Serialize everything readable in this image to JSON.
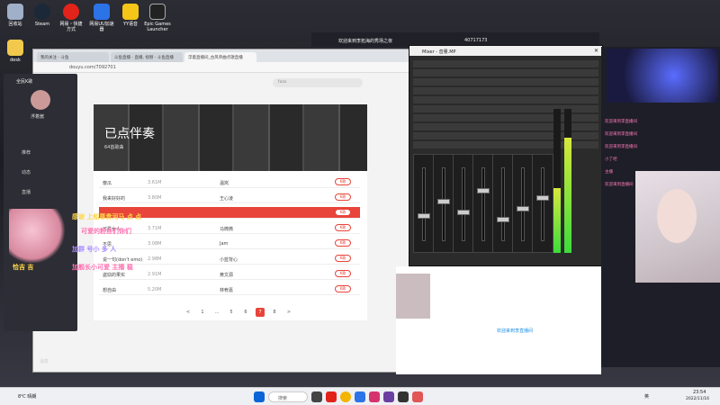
{
  "desktop": {
    "icons": [
      {
        "label": "回收站",
        "color": "#9fb0c8"
      },
      {
        "label": "Steam",
        "color": "#1b2838"
      },
      {
        "label": "网易・快捷\n方式",
        "color": "#e2231a"
      },
      {
        "label": "网易UU加速\n器",
        "color": "#2b73e6"
      },
      {
        "label": "YY语音",
        "color": "#f5c518"
      },
      {
        "label": "Epic Games\nLauncher",
        "color": "#222"
      },
      {
        "label": "desk",
        "color": "#f2c94c"
      }
    ]
  },
  "browser": {
    "tabs": [
      "我的关注 - 斗鱼",
      "斗鱼直播 - 直播, 视频 - 斗鱼直播",
      "浮着直播间_古风单曲点歌直播"
    ],
    "address": "douyu.com/7092701",
    "search_placeholder": "fazo"
  },
  "app_sidebar": {
    "title": "全民K歌",
    "user": "浮着酱",
    "items": [
      "推荐",
      "动态",
      "直播",
      "",
      "消息"
    ]
  },
  "panel": {
    "title": "已点伴奏",
    "subtitle": "64首歌曲",
    "rows": [
      {
        "name": "傻瓜",
        "size": "3.61M",
        "singer": "温岚",
        "btn": "K歌"
      },
      {
        "name": "我来好好的",
        "size": "3.80M",
        "singer": "王心凌",
        "btn": "K歌"
      },
      {
        "name": "",
        "size": "",
        "singer": "",
        "btn": "K歌",
        "highlight": true
      },
      {
        "name": "可爱女人",
        "size": "3.71M",
        "singer": "马微微",
        "btn": "K歌"
      },
      {
        "name": "不思",
        "size": "3.08M",
        "singer": "Jam",
        "btn": "K歌"
      },
      {
        "name": "说一句(don't emo)",
        "size": "2.98M",
        "singer": "小蓝背心",
        "btn": "K歌"
      },
      {
        "name": "盗窃的果实",
        "size": "2.91M",
        "singer": "黄文源",
        "btn": "K歌"
      },
      {
        "name": "想自由",
        "size": "5.20M",
        "singer": "林宥嘉",
        "btn": "K歌"
      }
    ],
    "pager": [
      "<",
      "1",
      "...",
      "5",
      "6",
      "7",
      "8",
      ">"
    ],
    "pager_current": "7"
  },
  "mixer": {
    "title": "Mixer - 音量.MP",
    "levels": [
      0.35,
      0.55,
      0.4,
      0.7,
      0.3,
      0.45,
      0.6
    ],
    "meter_levels": [
      0.45,
      0.8
    ]
  },
  "overlay": {
    "lines": [
      "感谢 上船尊贵河马 点 点",
      "可爱的粉丝们你们",
      "加群 号小 多 人",
      "恰吉 吉",
      "加舰长小可爱 主播 稳"
    ]
  },
  "stream": {
    "topbar": "欢迎来到李拓海的秀场之夜",
    "stats": "40717173",
    "chat": [
      "欢迎来到李直播间",
      "欢迎来到李直播间",
      "欢迎来到李直播间",
      "小了吧",
      "主播",
      "欢迎来到直播间"
    ],
    "lower_text": "欢迎来到李直播间"
  },
  "taskbar": {
    "weather": "8℃ 晴朗",
    "search": "搜索",
    "lang": "英",
    "time": "23:54",
    "date": "2022/11/16"
  }
}
